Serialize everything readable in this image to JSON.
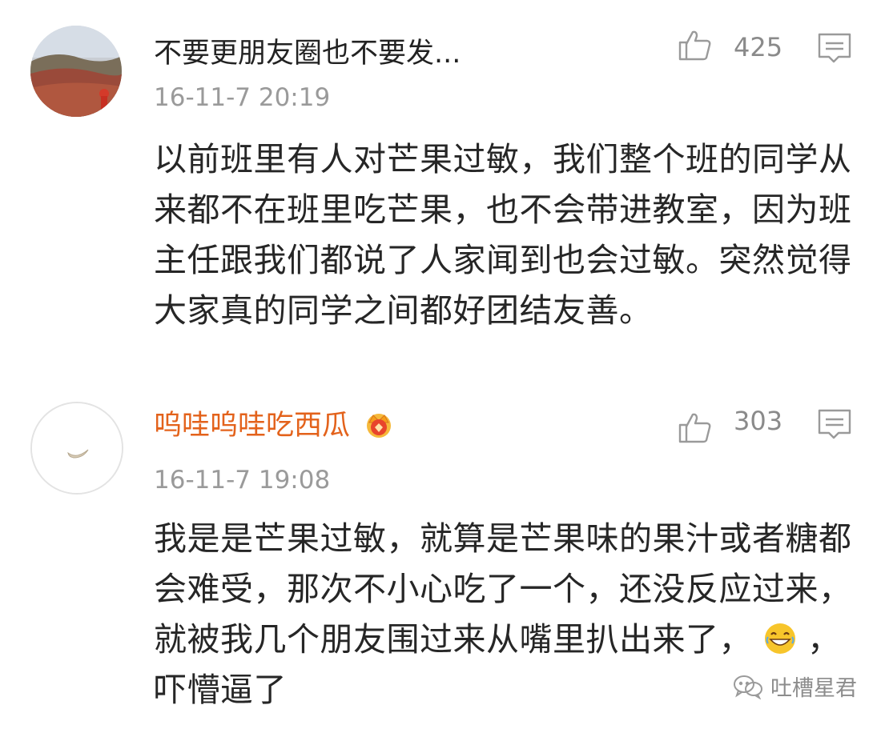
{
  "comments": [
    {
      "username": "不要更朋友圈也不要发...",
      "timestamp": "16-11-7 20:19",
      "likes": "425",
      "text": "以前班里有人对芒果过敏，我们整个班的同学从来都不在班里吃芒果，也不会带进教室，因为班主任跟我们都说了人家闻到也会过敏。突然觉得大家真的同学之间都好团结友善。"
    },
    {
      "username": "呜哇呜哇吃西瓜",
      "timestamp": "16-11-7 19:08",
      "likes": "303",
      "text_part1": "我是是芒果过敏，就算是芒果味的果汁或者糖都会难受，那次不小心吃了一个，还没反应过来，就被我几个朋友围过来从嘴里扒出来了，",
      "text_part2": "，吓懵逼了"
    }
  ],
  "watermark": "吐槽星君",
  "icons": {
    "like": "thumbs-up-icon",
    "reply": "comment-bubble-icon",
    "vip": "crown-badge-icon",
    "emoji": "laughing-emoji-icon",
    "watermark": "wechat-icon"
  },
  "colors": {
    "username_vip": "#e3621b",
    "timestamp": "#9a9a9a",
    "icon_gray": "#9a9a9a"
  }
}
